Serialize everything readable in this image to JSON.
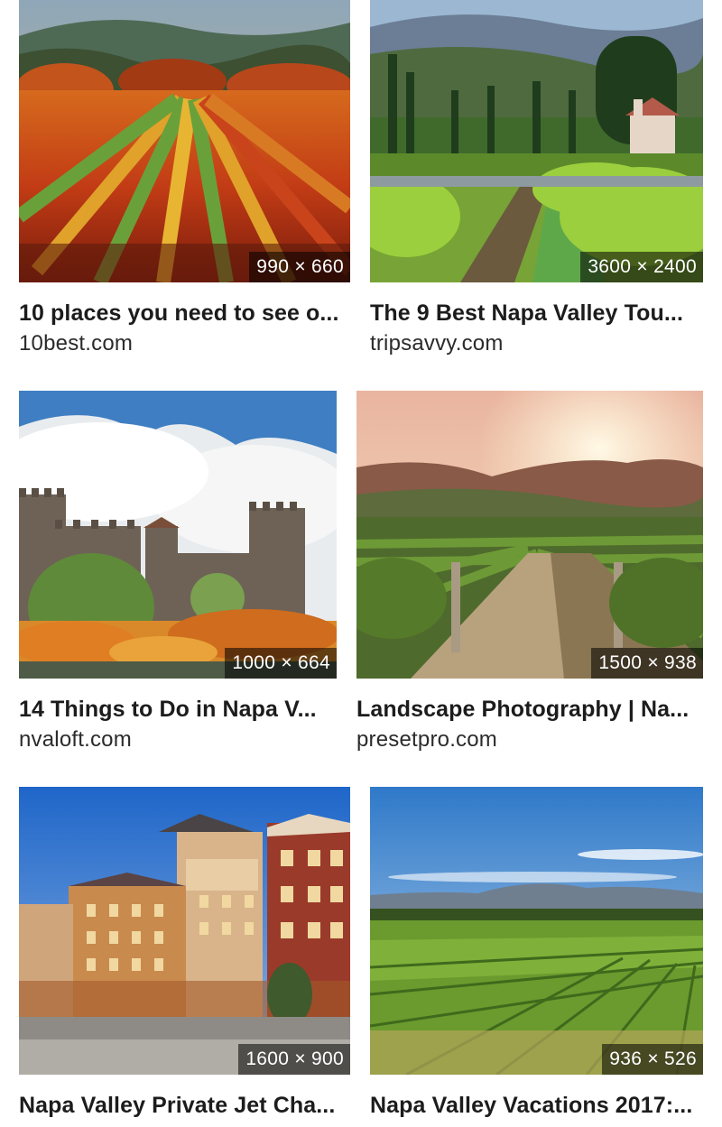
{
  "results": [
    {
      "title": "10 places you need to see o...",
      "source": "10best.com",
      "dimensions": "990 × 660",
      "image": "autumn vineyard rows with red and orange foliage"
    },
    {
      "title": "The 9 Best Napa Valley Tou...",
      "source": "tripsavvy.com",
      "dimensions": "3600 × 2400",
      "image": "green vineyard with cypress trees and small chapel"
    },
    {
      "title": "14 Things to Do in Napa V...",
      "source": "nvaloft.com",
      "dimensions": "1000 × 664",
      "image": "stone castle with towers behind autumn vines"
    },
    {
      "title": "Landscape Photography | Na...",
      "source": "presetpro.com",
      "dimensions": "1500 × 938",
      "image": "vineyard rows at sunset with hills"
    },
    {
      "title": "Napa Valley Private Jet Cha...",
      "source": "",
      "dimensions": "1600 × 900",
      "image": "Mediterranean style hotel building at dusk"
    },
    {
      "title": "Napa Valley Vacations 2017:...",
      "source": "",
      "dimensions": "936 × 526",
      "image": "wide green vineyard with mountains and blue sky"
    }
  ]
}
